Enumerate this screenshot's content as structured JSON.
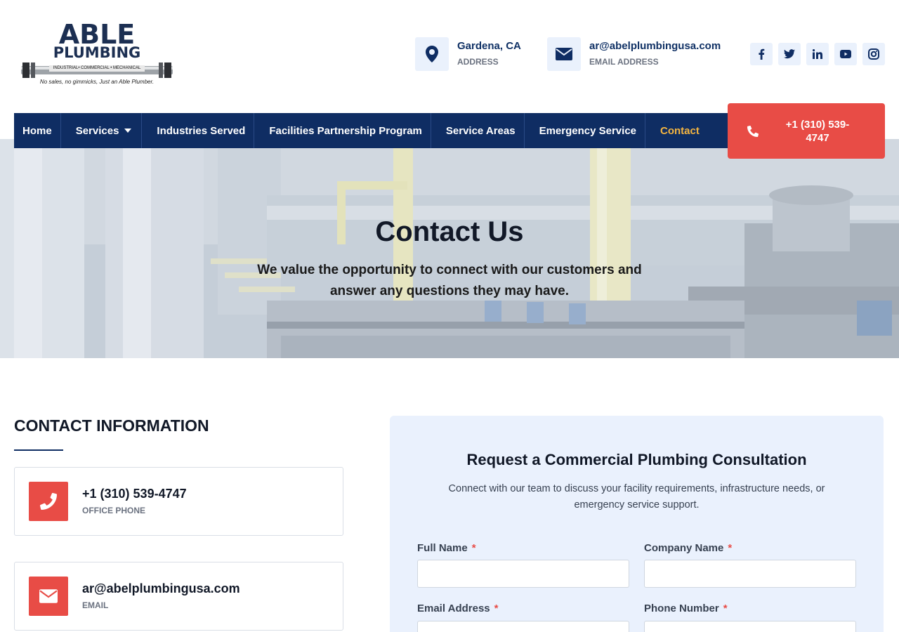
{
  "brand": {
    "name_line1": "ABLE",
    "name_line2": "PLUMBING",
    "sub": "INDUSTRIAL• COMMERCIAL • MECHANICAL",
    "tagline": "No sales, no gimmicks, Just an Able Plumber."
  },
  "header": {
    "address": {
      "value": "Gardena, CA",
      "label": "ADDRESS",
      "icon": "map-marker-icon"
    },
    "email": {
      "value": "ar@abelplumbingusa.com",
      "label": "EMAIL ADDRESS",
      "icon": "envelope-icon"
    },
    "social": [
      "facebook-icon",
      "twitter-icon",
      "linkedin-icon",
      "youtube-icon",
      "instagram-icon"
    ]
  },
  "nav": {
    "items": [
      "Home",
      "Services",
      "Industries Served",
      "Facilities Partnership Program",
      "Service Areas",
      "Emergency Service",
      "Contact"
    ],
    "active": "Contact",
    "call_label": "+1 (310) 539-4747"
  },
  "hero": {
    "title": "Contact Us",
    "subtitle": "We value the opportunity to connect with our customers and answer any questions they may have."
  },
  "contact_info": {
    "heading": "CONTACT INFORMATION",
    "phone": {
      "value": "+1 (310) 539-4747",
      "label": "OFFICE PHONE"
    },
    "email": {
      "value": "ar@abelplumbingusa.com",
      "label": "EMAIL"
    }
  },
  "form": {
    "title": "Request a Commercial Plumbing Consultation",
    "description": "Connect with our team to discuss your facility requirements, infrastructure needs, or emergency service support.",
    "required_mark": "*",
    "fields": {
      "full_name": "Full Name",
      "company_name": "Company Name",
      "email": "Email Address",
      "phone": "Phone Number"
    }
  },
  "colors": {
    "navy": "#0f2d63",
    "accent_red": "#e84c46",
    "active_nav": "#f5b540",
    "light_blue": "#eaf1fc"
  }
}
